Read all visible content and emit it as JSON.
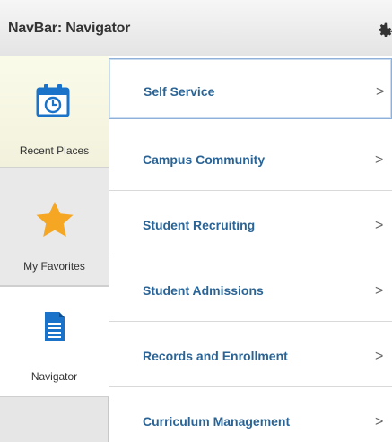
{
  "header": {
    "title": "NavBar: Navigator",
    "settings_icon": "gear-icon"
  },
  "tabs": [
    {
      "label": "Recent Places",
      "icon": "calendar-clock-icon",
      "color": "#1a73c8"
    },
    {
      "label": "My Favorites",
      "icon": "star-icon",
      "color": "#f5a623"
    },
    {
      "label": "Navigator",
      "icon": "document-icon",
      "color": "#1a73c8",
      "active": true
    }
  ],
  "menu": {
    "items": [
      {
        "label": "Self Service",
        "chevron": ">"
      },
      {
        "label": "Campus Community",
        "chevron": ">"
      },
      {
        "label": "Student Recruiting",
        "chevron": ">"
      },
      {
        "label": "Student Admissions",
        "chevron": ">"
      },
      {
        "label": "Records and Enrollment",
        "chevron": ">"
      },
      {
        "label": "Curriculum Management",
        "chevron": ">"
      }
    ]
  },
  "colors": {
    "link": "#2a6496",
    "accent": "#1a73c8",
    "star": "#f5a623"
  }
}
